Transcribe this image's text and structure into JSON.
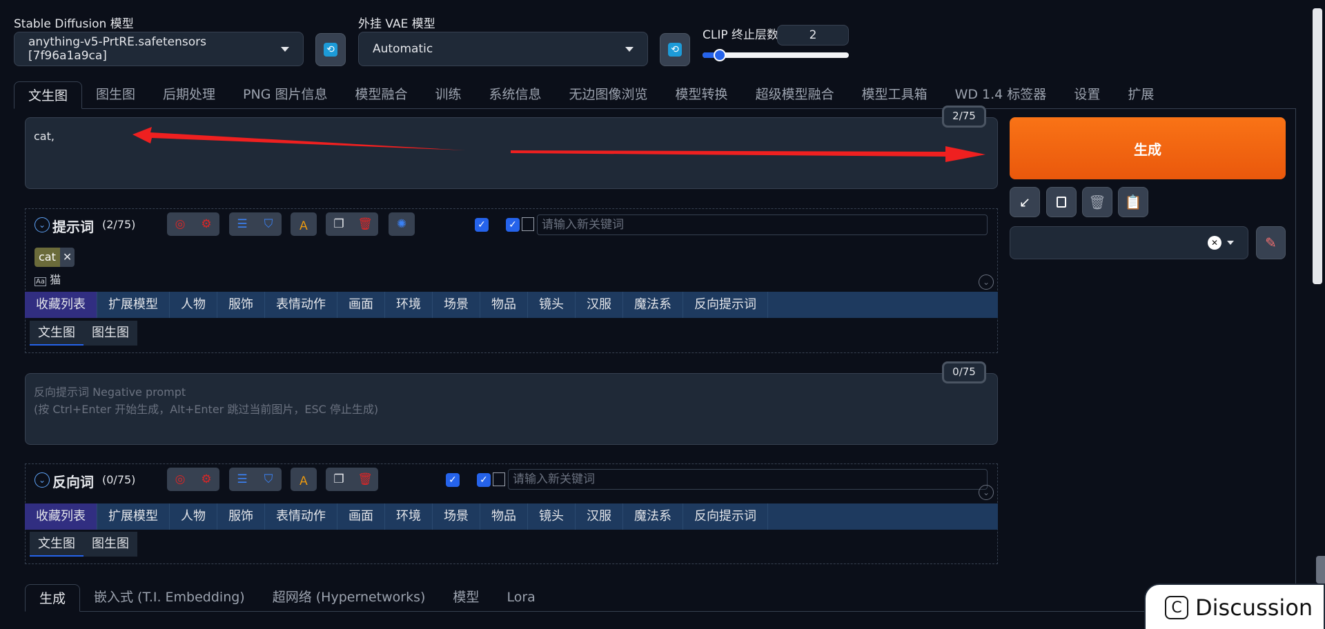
{
  "top": {
    "sd_model_label": "Stable Diffusion 模型",
    "sd_model_value": "anything-v5-PrtRE.safetensors [7f96a1a9ca]",
    "vae_label": "外挂 VAE 模型",
    "vae_value": "Automatic",
    "clip_label": "CLIP 终止层数",
    "clip_value": "2",
    "clip_slider_fraction": 0.12
  },
  "main_tabs": [
    "文生图",
    "图生图",
    "后期处理",
    "PNG 图片信息",
    "模型融合",
    "训练",
    "系统信息",
    "无边图像浏览",
    "模型转换",
    "超级模型融合",
    "模型工具箱",
    "WD 1.4 标签器",
    "设置",
    "扩展"
  ],
  "prompt": {
    "text": "cat,",
    "counter": "2/75"
  },
  "prompt_panel": {
    "title": "提示词",
    "count": "(2/75)",
    "keyword_placeholder": "请输入新关键词",
    "tag_text": "cat",
    "tag_translation": "猫"
  },
  "categories": [
    "收藏列表",
    "扩展模型",
    "人物",
    "服饰",
    "表情动作",
    "画面",
    "环境",
    "场景",
    "物品",
    "镜头",
    "汉服",
    "魔法系",
    "反向提示词"
  ],
  "sub_tabs": [
    "文生图",
    "图生图"
  ],
  "negative": {
    "placeholder_line1": "反向提示词 Negative prompt",
    "placeholder_line2": "(按 Ctrl+Enter 开始生成，Alt+Enter 跳过当前图片，ESC 停止生成)",
    "counter": "0/75"
  },
  "negative_panel": {
    "title": "反向词",
    "count": "(0/75)",
    "keyword_placeholder": "请输入新关键词"
  },
  "generate_label": "生成",
  "bottom_tabs": [
    "生成",
    "嵌入式 (T.I. Embedding)",
    "超网络 (Hypernetworks)",
    "模型",
    "Lora"
  ],
  "discussion_label": "Discussion",
  "colors": {
    "accent_orange": "#ea580c",
    "annotation_red": "#ef2020",
    "primary_blue": "#2563eb"
  }
}
